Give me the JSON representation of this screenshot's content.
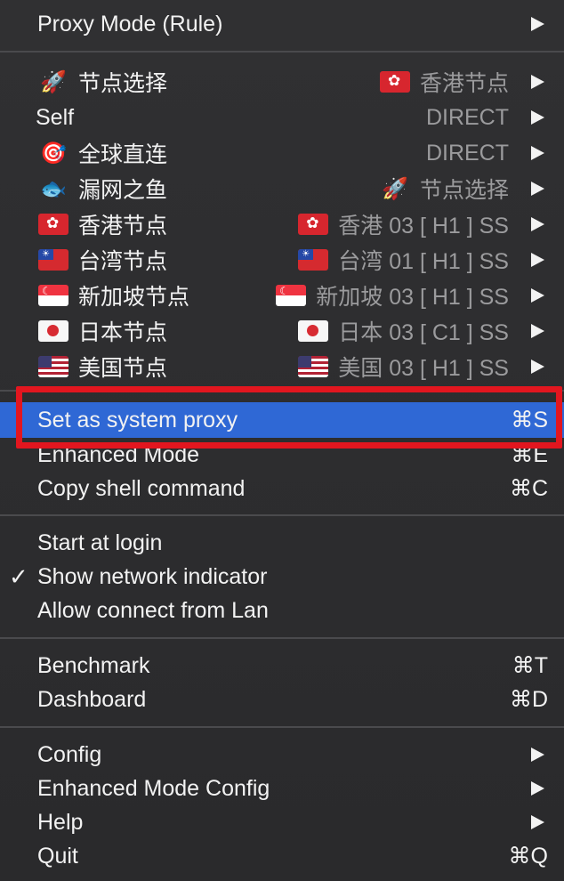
{
  "menu": {
    "proxy_mode": {
      "label": "Proxy Mode (Rule)",
      "arrow_icon": "chevron-right-icon"
    },
    "groups": [
      {
        "name_key": "node_select",
        "icon": "rocket-icon",
        "icon_glyph": "🚀",
        "label": "节点选择",
        "value_icon": "hk-flag-icon",
        "value": "香港节点"
      },
      {
        "name_key": "self",
        "icon": "",
        "icon_glyph": "",
        "label": "Self",
        "value_icon": "",
        "value": "DIRECT"
      },
      {
        "name_key": "global_direct",
        "icon": "dart-target-icon",
        "icon_glyph": "🎯",
        "label": "全球直连",
        "value_icon": "",
        "value": "DIRECT"
      },
      {
        "name_key": "missed_fish",
        "icon": "fish-icon",
        "icon_glyph": "🐟",
        "label": "漏网之鱼",
        "value_icon": "rocket-icon",
        "value_glyph": "🚀",
        "value": "节点选择"
      },
      {
        "name_key": "hk_nodes",
        "icon": "hk-flag-icon",
        "label": "香港节点",
        "value_icon": "hk-flag-icon",
        "value": "香港 03 [ H1 ] SS"
      },
      {
        "name_key": "tw_nodes",
        "icon": "tw-flag-icon",
        "label": "台湾节点",
        "value_icon": "tw-flag-icon",
        "value": "台湾 01 [ H1 ] SS"
      },
      {
        "name_key": "sg_nodes",
        "icon": "sg-flag-icon",
        "label": "新加坡节点",
        "value_icon": "sg-flag-icon",
        "value": "新加坡 03 [ H1 ] SS"
      },
      {
        "name_key": "jp_nodes",
        "icon": "jp-flag-icon",
        "label": "日本节点",
        "value_icon": "jp-flag-icon",
        "value": "日本 03 [ C1 ] SS"
      },
      {
        "name_key": "us_nodes",
        "icon": "us-flag-icon",
        "label": "美国节点",
        "value_icon": "us-flag-icon",
        "value": "美国 03 [ H1 ] SS"
      }
    ],
    "system_proxy": {
      "label": "Set as system proxy",
      "shortcut": "⌘S"
    },
    "enhanced_mode": {
      "label": "Enhanced Mode",
      "shortcut": "⌘E"
    },
    "copy_shell": {
      "label": "Copy shell command",
      "shortcut": "⌘C"
    },
    "start_login": {
      "label": "Start at login"
    },
    "network_indicator": {
      "label": "Show network indicator",
      "checked_glyph": "✓"
    },
    "allow_lan": {
      "label": "Allow connect from Lan"
    },
    "benchmark": {
      "label": "Benchmark",
      "shortcut": "⌘T"
    },
    "dashboard": {
      "label": "Dashboard",
      "shortcut": "⌘D"
    },
    "config": {
      "label": "Config"
    },
    "enhanced_config": {
      "label": "Enhanced Mode Config"
    },
    "help": {
      "label": "Help"
    },
    "quit": {
      "label": "Quit",
      "shortcut": "⌘Q"
    }
  },
  "colors": {
    "background": "#2b2b2d",
    "text": "#f2f2f2",
    "secondary_text": "#9b9b9d",
    "highlight": "#2f68d5",
    "annotation_red": "#e2161f"
  }
}
